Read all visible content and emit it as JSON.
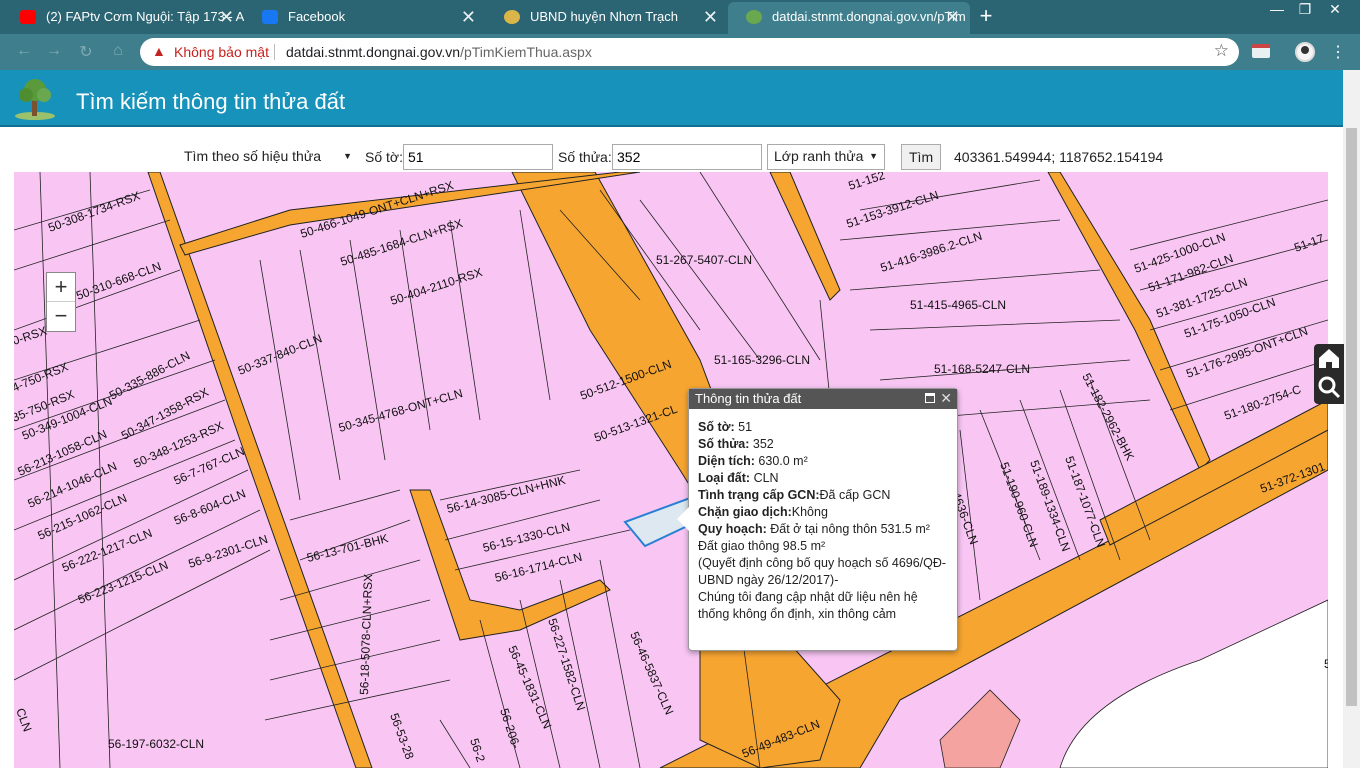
{
  "browser": {
    "tabs": [
      {
        "title": "(2) FAPtv Cơm Nguội: Tập 173 - A",
        "icon": "youtube-icon",
        "color": "#ff0000"
      },
      {
        "title": "Facebook",
        "icon": "facebook-icon",
        "color": "#1877f2"
      },
      {
        "title": "UBND huyện Nhơn Trạch",
        "icon": "government-emblem-icon",
        "color": "#d9b54a"
      },
      {
        "title": "datdai.stnmt.dongnai.gov.vn/pTim",
        "icon": "site-tree-icon",
        "color": "#6aa84f"
      }
    ],
    "new_tab": "+",
    "window_controls": {
      "minimize": "—",
      "maximize": "❐",
      "close": "✕"
    },
    "security_label": "Không bảo mật",
    "url_host": "datdai.stnmt.dongnai.gov.vn",
    "url_path": "/pTimKiemThua.aspx"
  },
  "page": {
    "title": "Tìm kiếm thông tin thửa đất"
  },
  "search": {
    "mode": "Tìm theo số hiệu thửa đất",
    "sheet_label": "Số tờ:",
    "sheet_value": "51",
    "parcel_label": "Số thửa:",
    "parcel_value": "352",
    "layer": "Lớp ranh thửa",
    "button": "Tìm",
    "coordinates": "403361.549944; 1187652.154194"
  },
  "map": {
    "zoom_in": "+",
    "zoom_out": "−",
    "colors": {
      "parcel": "#f9c6f4",
      "road": "#f7a531",
      "outline": "#222222",
      "selected": "#dde8f0"
    },
    "labels": [
      "50-308-1734-RSX",
      "50-310-668-CLN",
      "50-466-1049-ONT+CLN+RSX",
      "50-485-1684-CLN+RSX",
      "50-404-2110-RSX",
      "50-337-840-CLN",
      "50-335-886-CLN",
      "50-347-1358-RSX",
      "50-345-4768-ONT+CLN",
      "50-348-1253-RSX",
      "56-7-767-CLN",
      "56-8-604-CLN",
      "56-9-2301-CLN",
      "56-13-701-BHK",
      "56-14-3085-CLN+HNK",
      "56-15-1330-CLN",
      "56-16-1714-CLN",
      "50-512-1500-CLN",
      "50-513-1321-CL",
      "51-267-5407-CLN",
      "51-165-3296-CLN",
      "51-153-3912-CLN",
      "51-416-3986.2-CLN",
      "51-415-4965-CLN",
      "51-168-5247-CLN",
      "51-425-1000-CLN",
      "51-171-982-CLN",
      "51-381-1725-CLN",
      "51-175-1050-CLN",
      "51-176-2995-ONT+CLN",
      "51-180-2754-C",
      "51-182-2962-BHK",
      "51-372-1301",
      "51-190-960-CLN",
      "51-189-1334-CLN",
      "51-187-1077-CLN",
      "4636-CLN",
      "56-197-6032-CLN",
      "56-18-5078-CLN+RSX",
      "56-45-1831-CLN",
      "56-227-1582-CLN",
      "56-46-5837-CLN",
      "56-49-483-CLN",
      "50-349-1004-CLN",
      "56-213-1058-CLN",
      "56-214-1046-CLN",
      "56-215-1062-CLN",
      "56-222-1217-CLN",
      "56-223-1215-CLN",
      "4-750-RSX",
      "35-750-RSX",
      "0-RSX",
      "51-152",
      "51-17",
      "56-53-28",
      "56-206-",
      "56-2",
      "5",
      "CLN"
    ]
  },
  "popup": {
    "title": "Thông tin thửa đất",
    "fields": [
      {
        "label": "Số tờ:",
        "value": " 51"
      },
      {
        "label": "Số thửa:",
        "value": " 352"
      },
      {
        "label": "Diện tích:",
        "value": " 630.0 m²"
      },
      {
        "label": "Loại đất:",
        "value": " CLN"
      },
      {
        "label": "Tình trạng cấp GCN:",
        "value": "Đã cấp GCN"
      },
      {
        "label": "Chặn giao dịch:",
        "value": "Không"
      },
      {
        "label": "Quy hoạch:",
        "value": " Đất ở tại nông thôn 531.5 m²"
      }
    ],
    "extra_lines": [
      "Đất giao thông 98.5 m²",
      "(Quyết định công bố quy hoạch số 4696/QĐ-UBND ngày 26/12/2017)-",
      "Chúng tôi đang cập nhật dữ liệu nên hệ thống không ổn định, xin thông cảm"
    ]
  }
}
